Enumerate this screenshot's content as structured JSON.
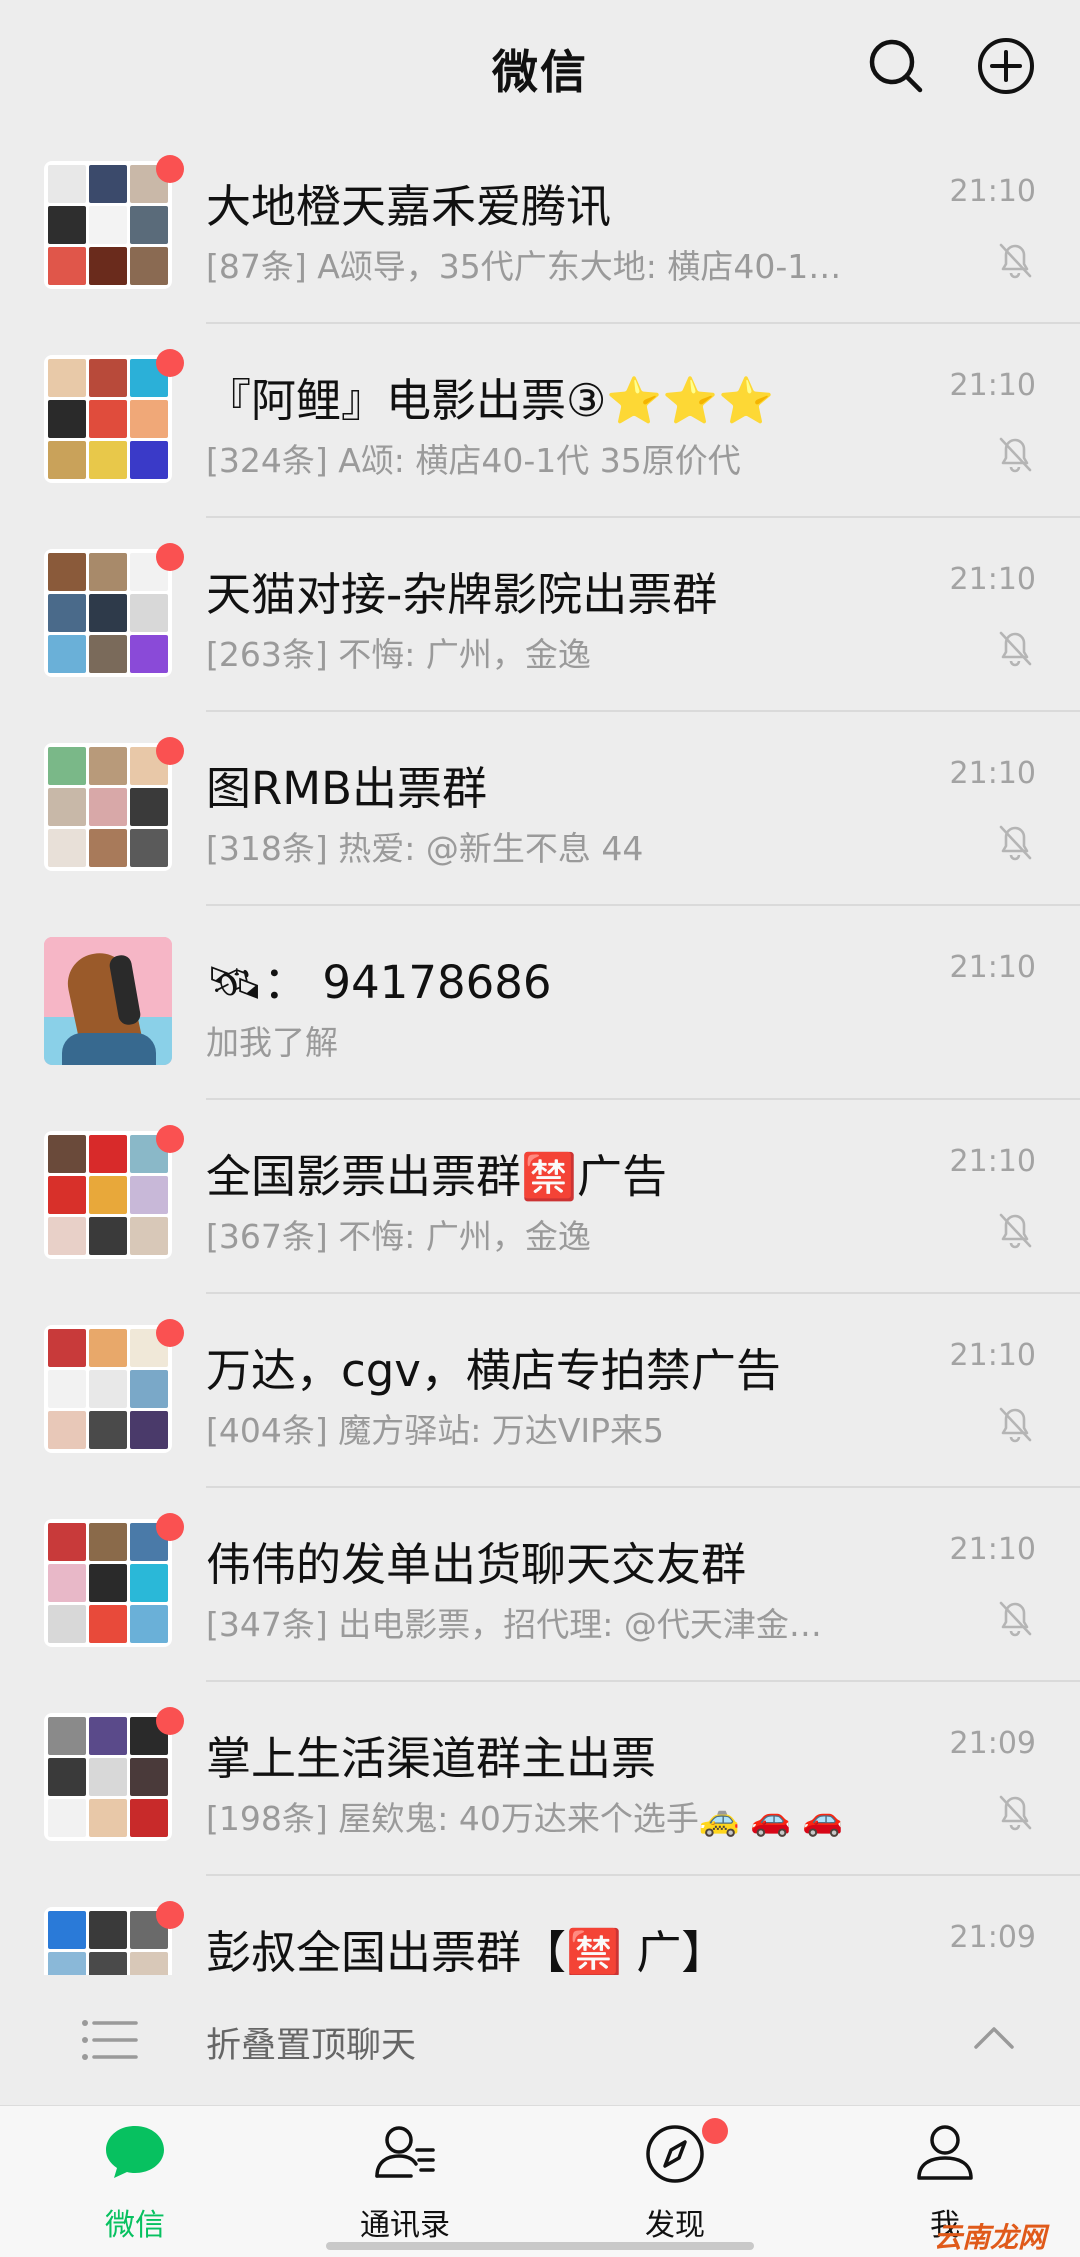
{
  "header": {
    "title": "微信"
  },
  "chats": [
    {
      "name": "大地橙天嘉禾爱腾讯",
      "preview": "[87条] A颂导，35代广东大地: 横店40-1…",
      "time": "21:10",
      "unread": true,
      "muted": true
    },
    {
      "name": "『阿鲤』电影出票③⭐⭐⭐",
      "preview": "[324条] A颂: 横店40-1代 35原价代",
      "time": "21:10",
      "unread": true,
      "muted": true
    },
    {
      "name": "天猫对接-杂牌影院出票群",
      "preview": "[263条] 不悔: 广州，金逸",
      "time": "21:10",
      "unread": true,
      "muted": true
    },
    {
      "name": "图RMB出票群",
      "preview": "[318条] 热爱: @新生不息 44",
      "time": "21:10",
      "unread": true,
      "muted": true
    },
    {
      "name": "🛰：  94178686",
      "preview": "加我了解",
      "time": "21:10",
      "unread": false,
      "muted": false
    },
    {
      "name": "全国影票出票群🈲广告",
      "preview": "[367条] 不悔: 广州，金逸",
      "time": "21:10",
      "unread": true,
      "muted": true
    },
    {
      "name": "万达，cgv，横店专拍禁广告",
      "preview": "[404条] 魔方驿站: 万达VIP来5",
      "time": "21:10",
      "unread": true,
      "muted": true
    },
    {
      "name": "伟伟的发单出货聊天交友群",
      "preview": "[347条] 出电影票，招代理: @代天津金…",
      "time": "21:10",
      "unread": true,
      "muted": true
    },
    {
      "name": "掌上生活渠道群主出票",
      "preview": "[198条] 屋欸鬼: 40万达来个选手🚕 🚗 🚗",
      "time": "21:09",
      "unread": true,
      "muted": true
    },
    {
      "name": "彭叔全国出票群【🈲 广】",
      "preview": "",
      "time": "21:09",
      "unread": true,
      "muted": false
    }
  ],
  "fold_bar": {
    "label": "折叠置顶聊天"
  },
  "tabs": [
    {
      "label": "微信",
      "active": true
    },
    {
      "label": "通讯录",
      "active": false
    },
    {
      "label": "发现",
      "active": false,
      "badge": true
    },
    {
      "label": "我",
      "active": false
    }
  ],
  "watermark": "云南龙网",
  "colors": {
    "accent_green": "#07c160",
    "badge_red": "#fa5151",
    "background": "#ededed"
  }
}
